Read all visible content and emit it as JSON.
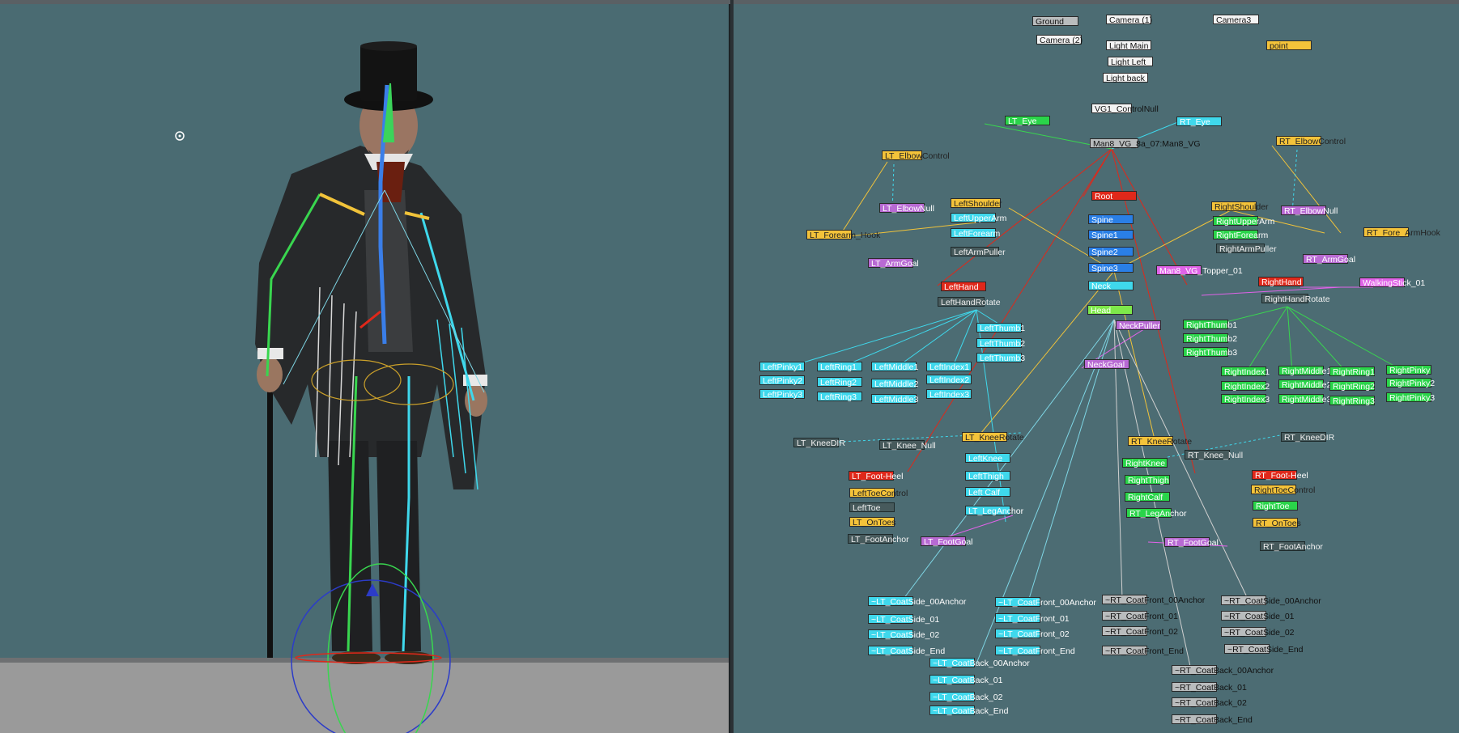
{
  "nodes": {
    "ground": "Ground",
    "camera1": "Camera (1)",
    "camera3": "Camera3",
    "camera2": "Camera (2)",
    "light_main": "Light Main",
    "point": "point",
    "light_left": "Light Left",
    "light_back": "Light back",
    "vg1_controlnull": "VG1_ControlNull",
    "lt_eye": "LT_Eye",
    "rt_eye": "RT_Eye",
    "man8_vg": "Man8_VG_8a_07:Man8_VG",
    "rt_elbowcontrol": "RT_ElbowControl",
    "lt_elbowcontrol": "LT_ElbowControl",
    "root": "Root",
    "leftshoulder": "LeftShoulder",
    "rightshoulder": "RightShoulder",
    "lt_elbownull": "LT_ElbowNull",
    "rt_elbownull": "RT_ElbowNull",
    "spine": "Spine",
    "leftupperarm": "LeftUpperArm",
    "rightupperarm": "RightUpperArm",
    "spine1": "Spine1",
    "leftforearm": "LeftForearm",
    "rightforearm": "RightForearm",
    "lt_forearm_hook": "LT_Forearm_Hook",
    "rt_fore_armhook": "RT_Fore_ArmHook",
    "spine2": "Spine2",
    "leftarmpuller": "LeftArmPuller",
    "rightarmpuller": "RightArmPuller",
    "lt_armgoal": "LT_ArmGoal",
    "rt_armgoal": "RT_ArmGoal",
    "spine3": "Spine3",
    "man8_vg_topper": "Man8_VG_Topper_01",
    "lefthand": "LeftHand",
    "neck": "Neck",
    "righthand": "RightHand",
    "walkingstick_01": "WalkingStick_01",
    "lefthandrotate": "LeftHandRotate",
    "righthandrotate": "RightHandRotate",
    "head": "Head",
    "neckpuller": "NeckPuller",
    "leftthumb1": "LeftThumb1",
    "rightthumb1": "RightThumb1",
    "leftthumb2": "LeftThumb2",
    "rightthumb2": "RightThumb2",
    "leftthumb3": "LeftThumb3",
    "rightthumb3": "RightThumb3",
    "neckgoal": "NeckGoal",
    "leftpinky1": "LeftPinky1",
    "leftring1": "LeftRing1",
    "leftmiddle1": "LeftMiddle1",
    "leftindex1": "LeftIndex1",
    "rightindex1": "RightIndex1",
    "rightmiddle1": "RightMiddle1",
    "rightring1": "RightRing1",
    "rightpinky": "RightPinky",
    "leftpinky2": "LeftPinky2",
    "leftring2": "LeftRing2",
    "leftmiddle2": "LeftMiddle2",
    "leftindex2": "LeftIndex2",
    "rightindex2": "RightIndex2",
    "rightmiddle2": "RightMiddle2",
    "rightring2": "RightRing2",
    "rightpinky2": "RightPinky2",
    "leftpinky3": "LeftPinky3",
    "leftring3": "LeftRing3",
    "leftmiddle3": "LeftMiddle3",
    "leftindex3": "LeftIndex3",
    "rightindex3": "RightIndex3",
    "rightmiddle3": "RightMiddle3",
    "rightring3": "RightRing3",
    "rightpinky3": "RightPinky3",
    "lt_kneerotate": "LT_KneeRotate",
    "rt_kneerotate": "RT_KneeRotate",
    "lt_kneedir": "LT_KneeDIR",
    "lt_knee_null": "LT_Knee_Null",
    "rt_kneedir": "RT_KneeDIR",
    "rt_knee_null": "RT_Knee_Null",
    "leftknee": "LeftKnee",
    "rightknee": "RightKnee",
    "lt_foot_heel": "LT_Foot-Heel",
    "rt_foot_heel": "RT_Foot-Heel",
    "leftthigh": "LeftThigh",
    "rightthigh": "RightThigh",
    "lefttoecontrol": "LeftToeControl",
    "righttoecontrol": "RightToeControl",
    "leftcalf": "Left Calf",
    "rightcalf": "RightCalf",
    "lefttoe": "LeftToe",
    "righttoe": "RightToe",
    "lt_leganchor": "LT_LegAnchor",
    "rt_leganchor": "RT_LegAnchor",
    "lt_ontoes": "LT_OnToes",
    "rt_ontoes": "RT_OnToes",
    "lt_footanchor": "LT_FootAnchor",
    "lt_footgoal": "LT_FootGoal",
    "rt_footgoal": "RT_FootGoal",
    "rt_footanchor": "RT_FootAnchor",
    "lt_coatside_00anchor": "~LT_CoatSide_00Anchor",
    "lt_coatfront_00anchor": "~LT_CoatFront_00Anchor",
    "rt_coatfront_00anchor": "~RT_CoatFront_00Anchor",
    "rt_coatside_00anchor": "~RT_CoatSide_00Anchor",
    "lt_coatside_01": "~LT_CoatSide_01",
    "lt_coatfront_01": "~LT_CoatFront_01",
    "rt_coatfront_01": "~RT_CoatFront_01",
    "rt_coatside_01": "~RT_CoatSide_01",
    "lt_coatside_02": "~LT_CoatSide_02",
    "lt_coatfront_02": "~LT_CoatFront_02",
    "rt_coatfront_02": "~RT_CoatFront_02",
    "rt_coatside_02": "~RT_CoatSide_02",
    "lt_coatside_end": "~LT_CoatSide_End",
    "lt_coatfront_end": "~LT_CoatFront_End",
    "rt_coatfront_end": "~RT_CoatFront_End",
    "rt_coatside_end": "~RT_CoatSide_End",
    "lt_coatback_00anchor": "~LT_CoatBack_00Anchor",
    "rt_coatback_00anchor": "~RT_CoatBack_00Anchor",
    "lt_coatback_01": "~LT_CoatBack_01",
    "rt_coatback_01": "~RT_CoatBack_01",
    "lt_coatback_02": "~LT_CoatBack_02",
    "rt_coatback_02": "~RT_CoatBack_02",
    "lt_coatback_end": "~LT_CoatBack_End",
    "rt_coatback_end": "~RT_CoatBack_End"
  }
}
